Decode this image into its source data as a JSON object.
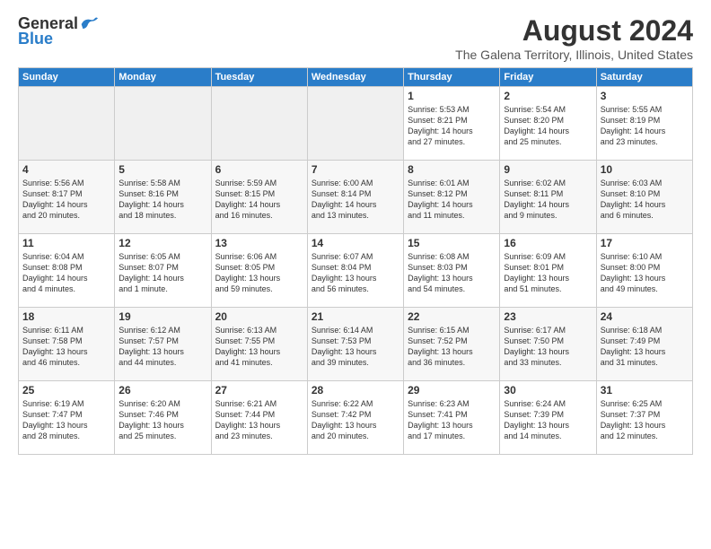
{
  "logo": {
    "general": "General",
    "blue": "Blue"
  },
  "title": "August 2024",
  "location": "The Galena Territory, Illinois, United States",
  "weekdays": [
    "Sunday",
    "Monday",
    "Tuesday",
    "Wednesday",
    "Thursday",
    "Friday",
    "Saturday"
  ],
  "weeks": [
    [
      {
        "day": "",
        "info": ""
      },
      {
        "day": "",
        "info": ""
      },
      {
        "day": "",
        "info": ""
      },
      {
        "day": "",
        "info": ""
      },
      {
        "day": "1",
        "info": "Sunrise: 5:53 AM\nSunset: 8:21 PM\nDaylight: 14 hours\nand 27 minutes."
      },
      {
        "day": "2",
        "info": "Sunrise: 5:54 AM\nSunset: 8:20 PM\nDaylight: 14 hours\nand 25 minutes."
      },
      {
        "day": "3",
        "info": "Sunrise: 5:55 AM\nSunset: 8:19 PM\nDaylight: 14 hours\nand 23 minutes."
      }
    ],
    [
      {
        "day": "4",
        "info": "Sunrise: 5:56 AM\nSunset: 8:17 PM\nDaylight: 14 hours\nand 20 minutes."
      },
      {
        "day": "5",
        "info": "Sunrise: 5:58 AM\nSunset: 8:16 PM\nDaylight: 14 hours\nand 18 minutes."
      },
      {
        "day": "6",
        "info": "Sunrise: 5:59 AM\nSunset: 8:15 PM\nDaylight: 14 hours\nand 16 minutes."
      },
      {
        "day": "7",
        "info": "Sunrise: 6:00 AM\nSunset: 8:14 PM\nDaylight: 14 hours\nand 13 minutes."
      },
      {
        "day": "8",
        "info": "Sunrise: 6:01 AM\nSunset: 8:12 PM\nDaylight: 14 hours\nand 11 minutes."
      },
      {
        "day": "9",
        "info": "Sunrise: 6:02 AM\nSunset: 8:11 PM\nDaylight: 14 hours\nand 9 minutes."
      },
      {
        "day": "10",
        "info": "Sunrise: 6:03 AM\nSunset: 8:10 PM\nDaylight: 14 hours\nand 6 minutes."
      }
    ],
    [
      {
        "day": "11",
        "info": "Sunrise: 6:04 AM\nSunset: 8:08 PM\nDaylight: 14 hours\nand 4 minutes."
      },
      {
        "day": "12",
        "info": "Sunrise: 6:05 AM\nSunset: 8:07 PM\nDaylight: 14 hours\nand 1 minute."
      },
      {
        "day": "13",
        "info": "Sunrise: 6:06 AM\nSunset: 8:05 PM\nDaylight: 13 hours\nand 59 minutes."
      },
      {
        "day": "14",
        "info": "Sunrise: 6:07 AM\nSunset: 8:04 PM\nDaylight: 13 hours\nand 56 minutes."
      },
      {
        "day": "15",
        "info": "Sunrise: 6:08 AM\nSunset: 8:03 PM\nDaylight: 13 hours\nand 54 minutes."
      },
      {
        "day": "16",
        "info": "Sunrise: 6:09 AM\nSunset: 8:01 PM\nDaylight: 13 hours\nand 51 minutes."
      },
      {
        "day": "17",
        "info": "Sunrise: 6:10 AM\nSunset: 8:00 PM\nDaylight: 13 hours\nand 49 minutes."
      }
    ],
    [
      {
        "day": "18",
        "info": "Sunrise: 6:11 AM\nSunset: 7:58 PM\nDaylight: 13 hours\nand 46 minutes."
      },
      {
        "day": "19",
        "info": "Sunrise: 6:12 AM\nSunset: 7:57 PM\nDaylight: 13 hours\nand 44 minutes."
      },
      {
        "day": "20",
        "info": "Sunrise: 6:13 AM\nSunset: 7:55 PM\nDaylight: 13 hours\nand 41 minutes."
      },
      {
        "day": "21",
        "info": "Sunrise: 6:14 AM\nSunset: 7:53 PM\nDaylight: 13 hours\nand 39 minutes."
      },
      {
        "day": "22",
        "info": "Sunrise: 6:15 AM\nSunset: 7:52 PM\nDaylight: 13 hours\nand 36 minutes."
      },
      {
        "day": "23",
        "info": "Sunrise: 6:17 AM\nSunset: 7:50 PM\nDaylight: 13 hours\nand 33 minutes."
      },
      {
        "day": "24",
        "info": "Sunrise: 6:18 AM\nSunset: 7:49 PM\nDaylight: 13 hours\nand 31 minutes."
      }
    ],
    [
      {
        "day": "25",
        "info": "Sunrise: 6:19 AM\nSunset: 7:47 PM\nDaylight: 13 hours\nand 28 minutes."
      },
      {
        "day": "26",
        "info": "Sunrise: 6:20 AM\nSunset: 7:46 PM\nDaylight: 13 hours\nand 25 minutes."
      },
      {
        "day": "27",
        "info": "Sunrise: 6:21 AM\nSunset: 7:44 PM\nDaylight: 13 hours\nand 23 minutes."
      },
      {
        "day": "28",
        "info": "Sunrise: 6:22 AM\nSunset: 7:42 PM\nDaylight: 13 hours\nand 20 minutes."
      },
      {
        "day": "29",
        "info": "Sunrise: 6:23 AM\nSunset: 7:41 PM\nDaylight: 13 hours\nand 17 minutes."
      },
      {
        "day": "30",
        "info": "Sunrise: 6:24 AM\nSunset: 7:39 PM\nDaylight: 13 hours\nand 14 minutes."
      },
      {
        "day": "31",
        "info": "Sunrise: 6:25 AM\nSunset: 7:37 PM\nDaylight: 13 hours\nand 12 minutes."
      }
    ]
  ]
}
